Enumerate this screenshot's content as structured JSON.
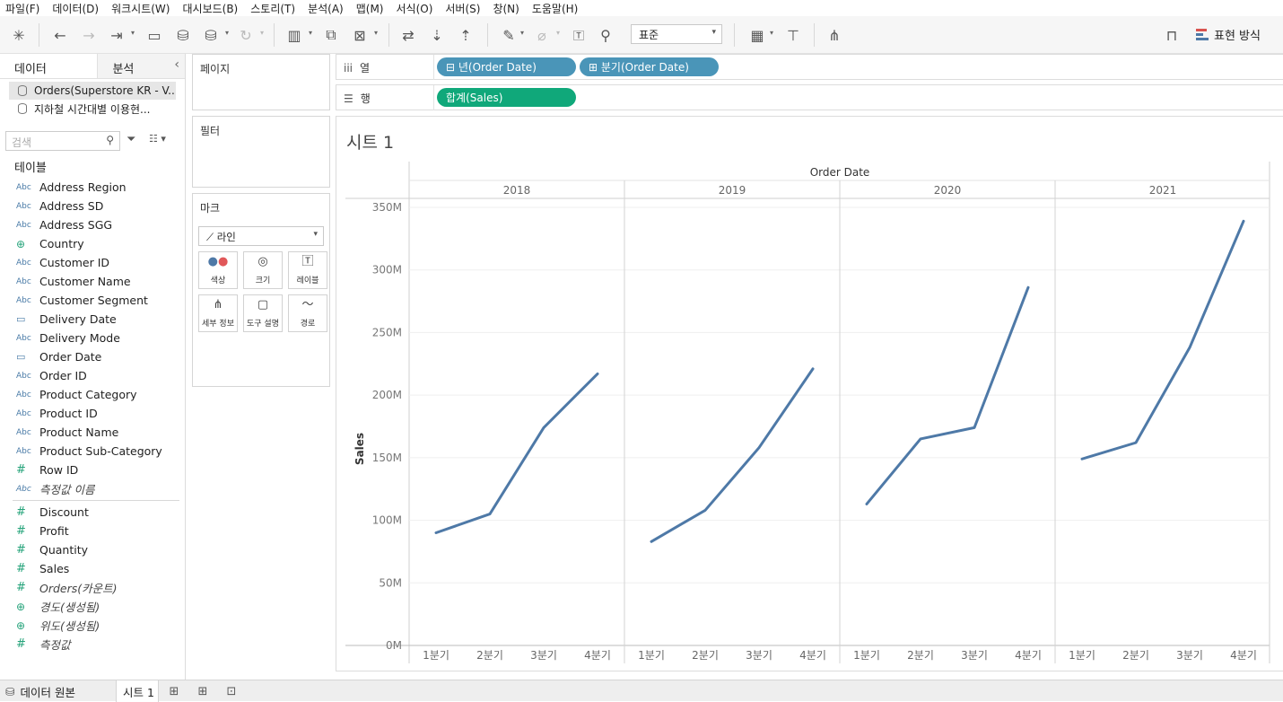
{
  "menu": [
    "파일(F)",
    "데이터(D)",
    "워크시트(W)",
    "대시보드(B)",
    "스토리(T)",
    "분석(A)",
    "맵(M)",
    "서식(O)",
    "서버(S)",
    "창(N)",
    "도움말(H)"
  ],
  "toolbar": {
    "fit_value": "표준",
    "show_me_label": "표현 방식"
  },
  "data_pane": {
    "tab_data": "데이터",
    "tab_analytics": "분석",
    "datasources": [
      {
        "name": "Orders(Superstore KR - V..."
      },
      {
        "name": "지하철 시간대별 이용현..."
      }
    ],
    "search_placeholder": "검색",
    "tables_title": "테이블",
    "dimensions": [
      {
        "type": "Abc",
        "name": "Address Region"
      },
      {
        "type": "Abc",
        "name": "Address SD"
      },
      {
        "type": "Abc",
        "name": "Address SGG"
      },
      {
        "type": "geo",
        "name": "Country"
      },
      {
        "type": "Abc",
        "name": "Customer ID"
      },
      {
        "type": "Abc",
        "name": "Customer Name"
      },
      {
        "type": "Abc",
        "name": "Customer Segment"
      },
      {
        "type": "date",
        "name": "Delivery Date"
      },
      {
        "type": "Abc",
        "name": "Delivery Mode"
      },
      {
        "type": "date",
        "name": "Order Date"
      },
      {
        "type": "Abc",
        "name": "Order ID"
      },
      {
        "type": "Abc",
        "name": "Product Category"
      },
      {
        "type": "Abc",
        "name": "Product ID"
      },
      {
        "type": "Abc",
        "name": "Product Name"
      },
      {
        "type": "Abc",
        "name": "Product Sub-Category"
      },
      {
        "type": "num",
        "name": "Row ID"
      },
      {
        "type": "Abc",
        "name": "측정값 이름",
        "italic": true
      }
    ],
    "measures": [
      {
        "type": "num",
        "name": "Discount"
      },
      {
        "type": "num",
        "name": "Profit"
      },
      {
        "type": "num",
        "name": "Quantity"
      },
      {
        "type": "num",
        "name": "Sales"
      },
      {
        "type": "num",
        "name": "Orders(카운트)",
        "italic": true
      },
      {
        "type": "geo",
        "name": "경도(생성됨)",
        "italic": true
      },
      {
        "type": "geo",
        "name": "위도(생성됨)",
        "italic": true
      },
      {
        "type": "num",
        "name": "측정값",
        "italic": true
      }
    ]
  },
  "cards": {
    "pages": "페이지",
    "filters": "필터",
    "marks": "마크",
    "mark_type": "라인",
    "mark_buttons": [
      "색상",
      "크기",
      "레이블",
      "세부 정보",
      "도구 설명",
      "경로"
    ]
  },
  "shelves": {
    "columns_label": "열",
    "rows_label": "행",
    "column_pills": [
      "년(Order Date)",
      "분기(Order Date)"
    ],
    "row_pills": [
      "합계(Sales)"
    ]
  },
  "sheet": {
    "title": "시트 1"
  },
  "colors": {
    "line": "#4e79a7",
    "dimension_pill": "#4a95b8",
    "measure_pill": "#10a87a"
  },
  "chart_data": {
    "type": "line",
    "title": "시트 1",
    "header_label": "Order Date",
    "ylabel": "Sales",
    "ylim": [
      0,
      350000000
    ],
    "y_ticks": [
      "0M",
      "50M",
      "100M",
      "150M",
      "200M",
      "250M",
      "300M",
      "350M"
    ],
    "y_tick_values": [
      0,
      50000000,
      100000000,
      150000000,
      200000000,
      250000000,
      300000000,
      350000000
    ],
    "categories": [
      "1분기",
      "2분기",
      "3분기",
      "4분기"
    ],
    "panels": [
      {
        "name": "2018",
        "values": [
          90000000,
          105000000,
          174000000,
          217000000
        ]
      },
      {
        "name": "2019",
        "values": [
          83000000,
          108000000,
          158000000,
          221000000
        ]
      },
      {
        "name": "2020",
        "values": [
          113000000,
          165000000,
          174000000,
          286000000
        ]
      },
      {
        "name": "2021",
        "values": [
          149000000,
          162000000,
          238000000,
          339000000
        ]
      }
    ],
    "grid": true
  },
  "bottom": {
    "datasource_tab": "데이터 원본",
    "sheet_tab": "시트 1"
  }
}
